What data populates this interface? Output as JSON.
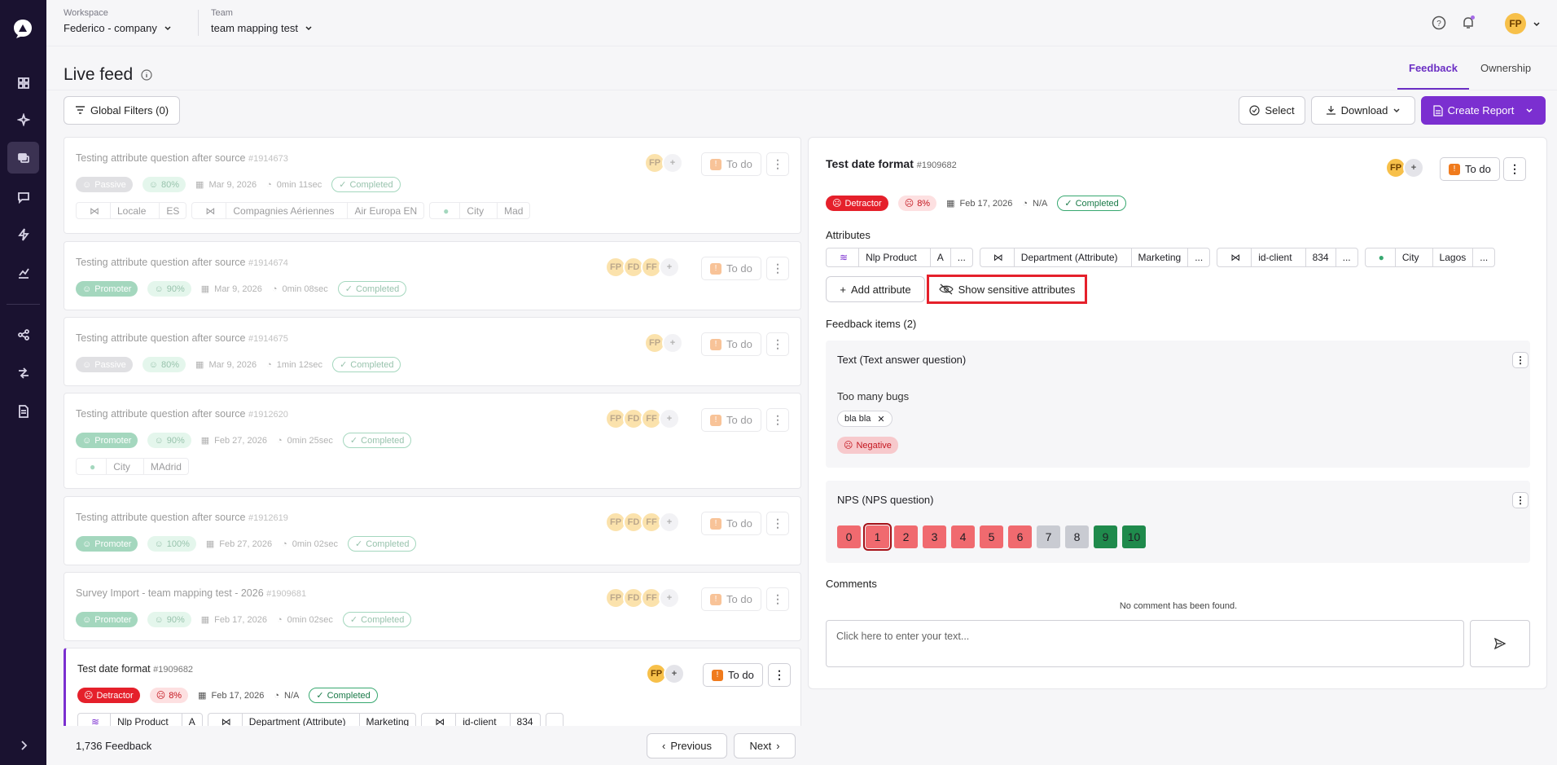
{
  "topbar": {
    "workspace_label": "Workspace",
    "workspace_value": "Federico - company",
    "team_label": "Team",
    "team_value": "team mapping test",
    "user_initials": "FP"
  },
  "page": {
    "title": "Live feed",
    "tabs": [
      {
        "label": "Feedback",
        "active": true
      },
      {
        "label": "Ownership",
        "active": false
      }
    ],
    "global_filters": "Global Filters (0)",
    "select": "Select",
    "download": "Download",
    "create_report": "Create Report"
  },
  "feed": [
    {
      "title": "Testing attribute question after source",
      "id": "#1914673",
      "type": "Passive",
      "pct": "80%",
      "date": "Mar 9, 2026",
      "duration": "0min 11sec",
      "status": "Completed",
      "assignees": [
        "FP"
      ],
      "todo": "To do",
      "attrs": [
        [
          "Locale",
          "ES"
        ],
        [
          "Compagnies Aériennes",
          "Air Europa EN"
        ],
        [
          "City",
          "Mad"
        ]
      ]
    },
    {
      "title": "Testing attribute question after source",
      "id": "#1914674",
      "type": "Promoter",
      "pct": "90%",
      "date": "Mar 9, 2026",
      "duration": "0min 08sec",
      "status": "Completed",
      "assignees": [
        "FP",
        "FD",
        "FF"
      ],
      "todo": "To do",
      "attrs": []
    },
    {
      "title": "Testing attribute question after source",
      "id": "#1914675",
      "type": "Passive",
      "pct": "80%",
      "date": "Mar 9, 2026",
      "duration": "1min 12sec",
      "status": "Completed",
      "assignees": [
        "FP"
      ],
      "todo": "To do",
      "attrs": []
    },
    {
      "title": "Testing attribute question after source",
      "id": "#1912620",
      "type": "Promoter",
      "pct": "90%",
      "date": "Feb 27, 2026",
      "duration": "0min 25sec",
      "status": "Completed",
      "assignees": [
        "FP",
        "FD",
        "FF"
      ],
      "todo": "To do",
      "attrs": [
        [
          "City",
          "MAdrid"
        ]
      ]
    },
    {
      "title": "Testing attribute question after source",
      "id": "#1912619",
      "type": "Promoter",
      "pct": "100%",
      "date": "Feb 27, 2026",
      "duration": "0min 02sec",
      "status": "Completed",
      "assignees": [
        "FP",
        "FD",
        "FF"
      ],
      "todo": "To do",
      "attrs": []
    },
    {
      "title": "Survey Import - team mapping test - 2026",
      "id": "#1909681",
      "type": "Promoter",
      "pct": "90%",
      "date": "Feb 17, 2026",
      "duration": "0min 02sec",
      "status": "Completed",
      "assignees": [
        "FP",
        "FD",
        "FF"
      ],
      "todo": "To do",
      "attrs": []
    },
    {
      "title": "Test date format",
      "id": "#1909682",
      "type": "Detractor",
      "pct": "8%",
      "date": "Feb 17, 2026",
      "duration": "N/A",
      "status": "Completed",
      "assignees": [
        "FP"
      ],
      "todo": "To do",
      "attrs": [
        [
          "Nlp Product",
          "A"
        ],
        [
          "Department (Attribute)",
          "Marketing"
        ],
        [
          "id-client",
          "834"
        ]
      ]
    }
  ],
  "footer": {
    "count": "1,736 Feedback",
    "previous": "Previous",
    "next": "Next"
  },
  "detail": {
    "title": "Test date format",
    "id": "#1909682",
    "assignee": "FP",
    "todo": "To do",
    "type": "Detractor",
    "pct": "8%",
    "date": "Feb 17, 2026",
    "duration": "N/A",
    "status": "Completed",
    "attributes_label": "Attributes",
    "attributes": [
      {
        "name": "Nlp Product",
        "value": "A"
      },
      {
        "name": "Department (Attribute)",
        "value": "Marketing"
      },
      {
        "name": "id-client",
        "value": "834"
      },
      {
        "name": "City",
        "value": "Lagos"
      }
    ],
    "more": "...",
    "add_attribute": "Add attribute",
    "show_sensitive": "Show sensitive attributes",
    "feedback_items_label": "Feedback items (2)",
    "text_q": "Text (Text answer question)",
    "text_answer": "Too many bugs",
    "tag": "bla bla",
    "sentiment": "Negative",
    "nps_q": "NPS (NPS question)",
    "nps_scores": [
      "0",
      "1",
      "2",
      "3",
      "4",
      "5",
      "6",
      "7",
      "8",
      "9",
      "10"
    ],
    "nps_selected": "1",
    "comments_label": "Comments",
    "no_comment": "No comment has been found.",
    "comment_placeholder": "Click here to enter your text..."
  },
  "colors": {
    "accent": "#7b2fd0",
    "sidebar": "#1a1230",
    "promoter": "#37a870",
    "detractor": "#e5202b",
    "nps_red": "#f06a6f",
    "nps_gray": "#c9cbd2",
    "nps_green": "#1f8a4c"
  }
}
